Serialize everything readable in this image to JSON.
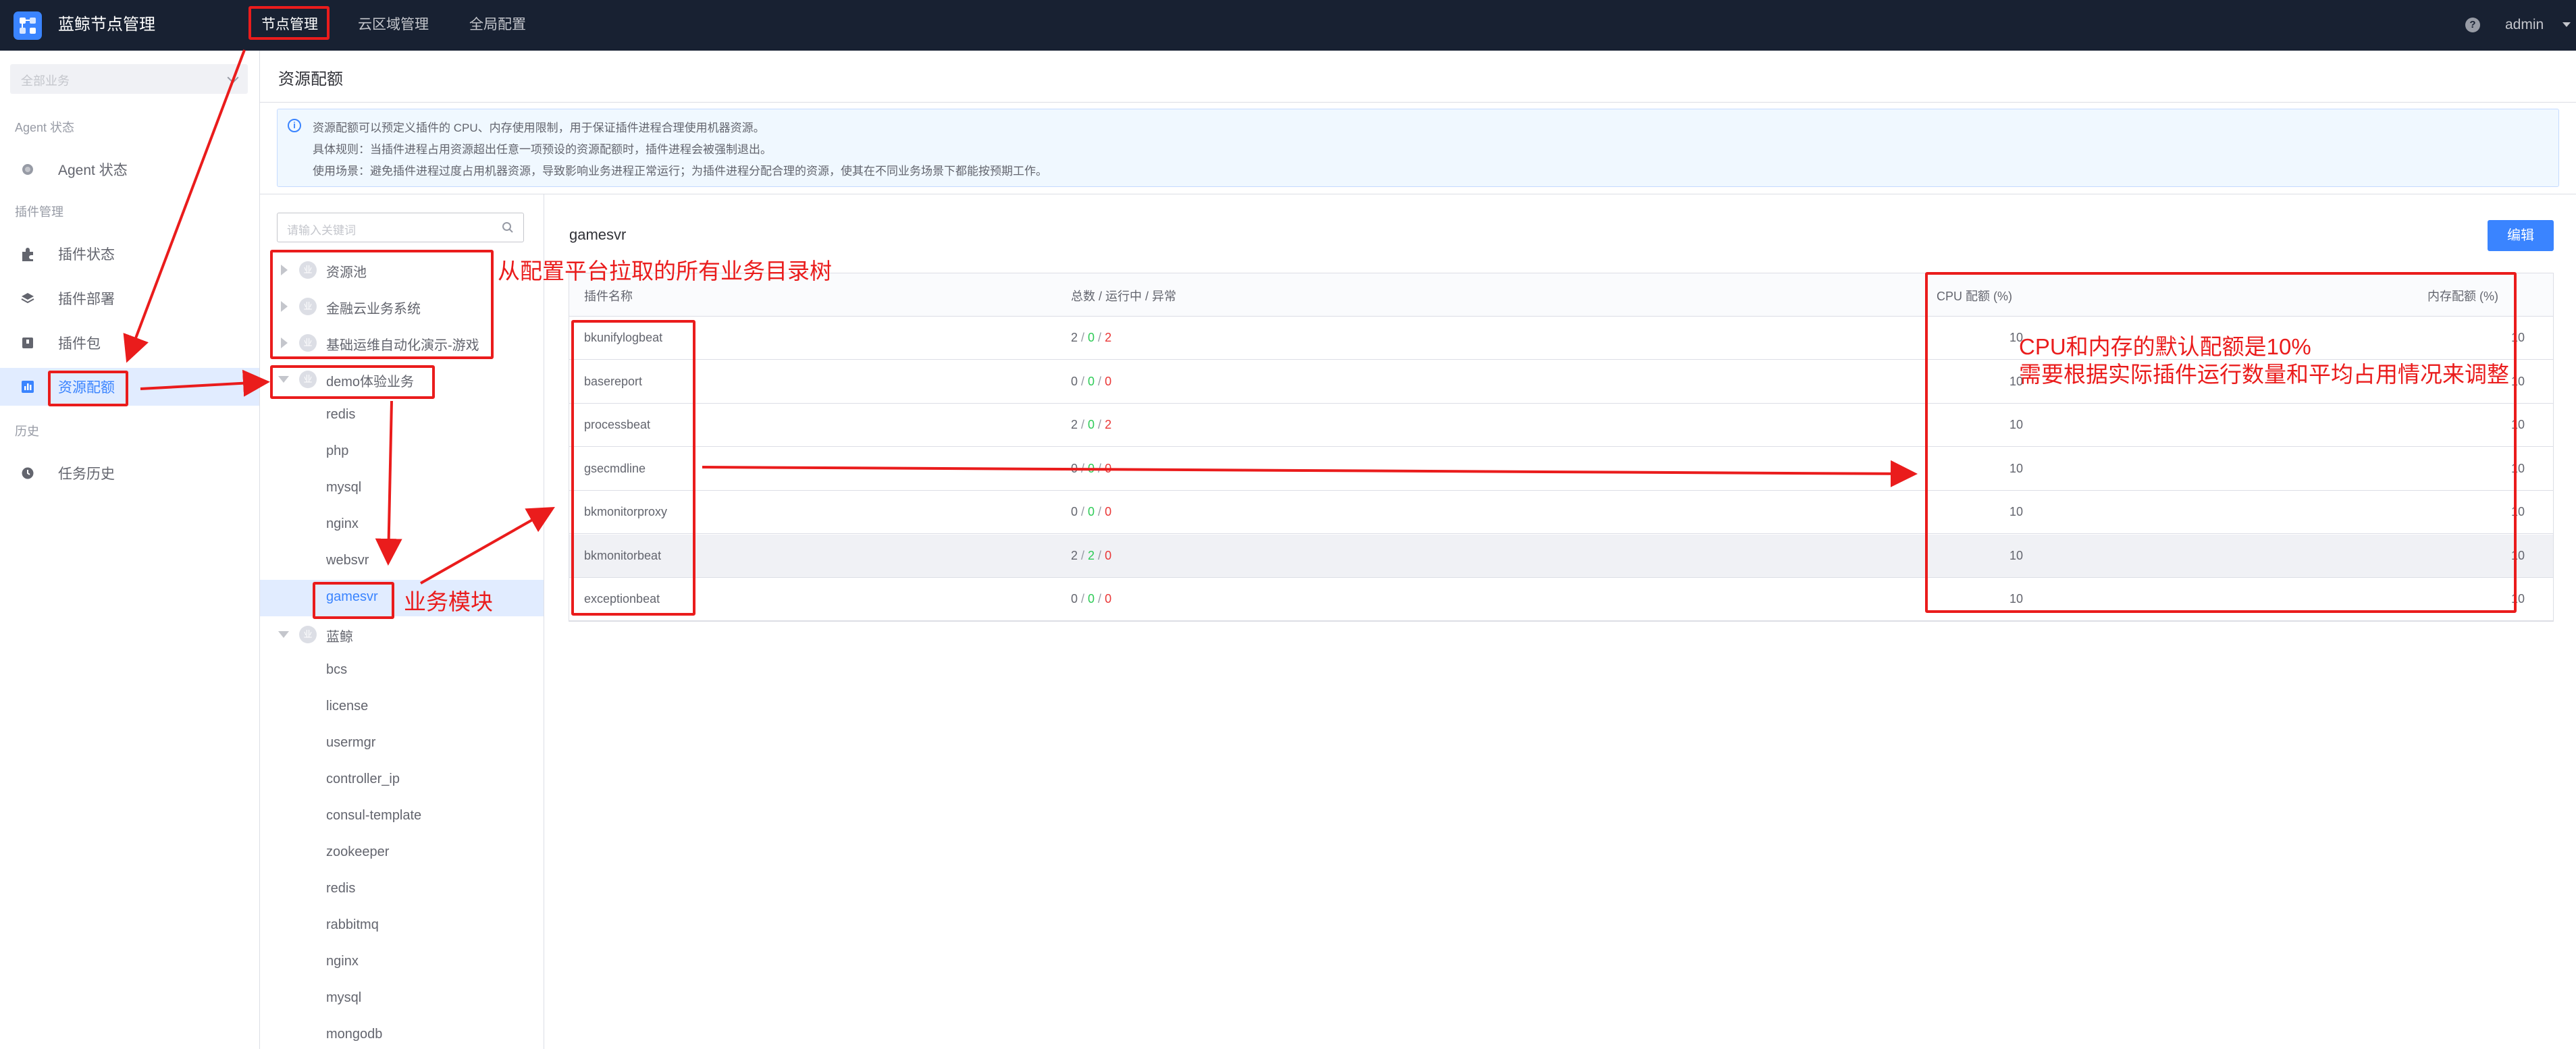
{
  "header": {
    "app_title": "蓝鲸节点管理",
    "nav": [
      "节点管理",
      "云区域管理",
      "全局配置"
    ],
    "user": "admin"
  },
  "sidebar": {
    "biz_placeholder": "全部业务",
    "groups": {
      "agent": "Agent 状态",
      "plugin": "插件管理",
      "history": "历史"
    },
    "items": {
      "agent_status": "Agent 状态",
      "plugin_status": "插件状态",
      "plugin_deploy": "插件部署",
      "plugin_package": "插件包",
      "resource_quota": "资源配额",
      "task_history": "任务历史"
    }
  },
  "page": {
    "title": "资源配额",
    "notice": [
      "资源配额可以预定义插件的 CPU、内存使用限制，用于保证插件进程合理使用机器资源。",
      "具体规则：当插件进程占用资源超出任意一项预设的资源配额时，插件进程会被强制退出。",
      "使用场景：避免插件进程过度占用机器资源，导致影响业务进程正常运行；为插件进程分配合理的资源，使其在不同业务场景下都能按预期工作。"
    ]
  },
  "tree": {
    "search_placeholder": "请输入关键词",
    "nodes": [
      {
        "label": "资源池",
        "badge": "业"
      },
      {
        "label": "金融云业务系统",
        "badge": "业"
      },
      {
        "label": "基础运维自动化演示-游戏",
        "badge": "业"
      },
      {
        "label": "demo体验业务",
        "badge": "业"
      },
      {
        "label": "redis"
      },
      {
        "label": "php"
      },
      {
        "label": "mysql"
      },
      {
        "label": "nginx"
      },
      {
        "label": "websvr"
      },
      {
        "label": "gamesvr"
      },
      {
        "label": "蓝鲸",
        "badge": "业"
      },
      {
        "label": "bcs"
      },
      {
        "label": "license"
      },
      {
        "label": "usermgr"
      },
      {
        "label": "controller_ip"
      },
      {
        "label": "consul-template"
      },
      {
        "label": "zookeeper"
      },
      {
        "label": "redis"
      },
      {
        "label": "rabbitmq"
      },
      {
        "label": "nginx"
      },
      {
        "label": "mysql"
      },
      {
        "label": "mongodb"
      }
    ]
  },
  "content": {
    "module_title": "gamesvr",
    "edit_label": "编辑",
    "columns": {
      "name": "插件名称",
      "status": "总数 / 运行中 / 异常",
      "cpu": "CPU 配额 (%)",
      "mem": "内存配额 (%)"
    },
    "rows": [
      {
        "name": "bkunifylogbeat",
        "total": "2",
        "running": "0",
        "error": "2",
        "cpu": "10",
        "mem": "10"
      },
      {
        "name": "basereport",
        "total": "0",
        "running": "0",
        "error": "0",
        "cpu": "10",
        "mem": "10"
      },
      {
        "name": "processbeat",
        "total": "2",
        "running": "0",
        "error": "2",
        "cpu": "10",
        "mem": "10"
      },
      {
        "name": "gsecmdline",
        "total": "0",
        "running": "0",
        "error": "0",
        "cpu": "10",
        "mem": "10"
      },
      {
        "name": "bkmonitorproxy",
        "total": "0",
        "running": "0",
        "error": "0",
        "cpu": "10",
        "mem": "10"
      },
      {
        "name": "bkmonitorbeat",
        "total": "2",
        "running": "2",
        "error": "0",
        "cpu": "10",
        "mem": "10"
      },
      {
        "name": "exceptionbeat",
        "total": "0",
        "running": "0",
        "error": "0",
        "cpu": "10",
        "mem": "10"
      }
    ]
  },
  "annotations": {
    "tree_note": "从配置平台拉取的所有业务目录树",
    "module_note": "业务模块",
    "quota_note_1": "CPU和内存的默认配额是10%",
    "quota_note_2": "需要根据实际插件运行数量和平均占用情况来调整"
  },
  "colors": {
    "topbar": "#182132",
    "primary": "#3a84ff",
    "running": "#2dcb56",
    "error": "#ea3636",
    "annotation": "#ea1c1c"
  }
}
